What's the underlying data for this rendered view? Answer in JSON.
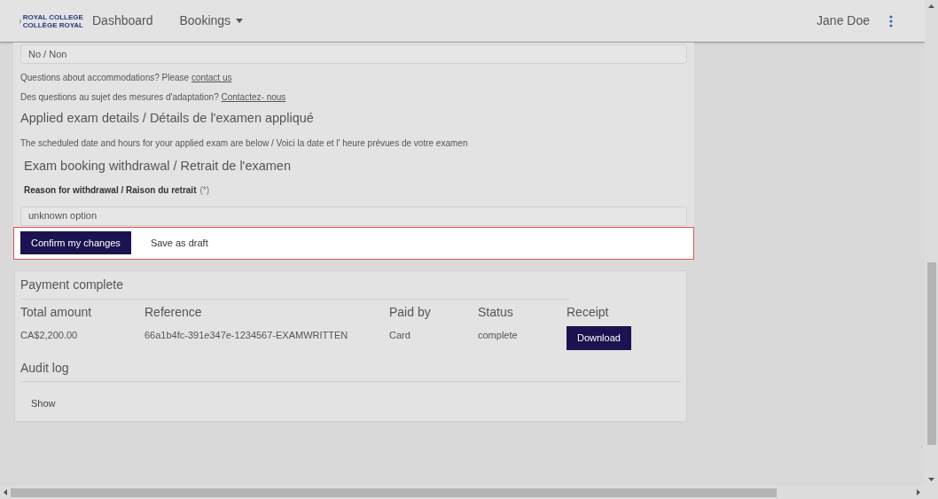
{
  "header": {
    "logo_lines": [
      "ROYAL COLLEGE",
      "COLLÈGE ROYAL"
    ],
    "nav": [
      {
        "label": "Dashboard",
        "has_menu": false
      },
      {
        "label": "Bookings",
        "has_menu": true
      }
    ],
    "user": "Jane Doe"
  },
  "form": {
    "accommodation_value": "No / Non",
    "help_lines": [
      {
        "text": "Questions about accommodations? Please ",
        "link": "contact us"
      },
      {
        "text": "Des questions au sujet des mesures d'adaptation? ",
        "link": "Contactez- nous"
      }
    ],
    "applied_heading": "Applied exam details / Détails de l'examen appliqué",
    "applied_note": "The scheduled date and hours for your applied exam are below / Voici la date et l' heure prévues de votre examen",
    "withdrawal_heading": "Exam booking withdrawal / Retrait de l'examen",
    "reason_label": "Reason for withdrawal / Raison du retrait",
    "reason_required": "(*)",
    "reason_value": "unknown option",
    "actions": [
      {
        "label": "Confirm my changes",
        "kind": "primary"
      },
      {
        "label": "Save as draft",
        "kind": "plain"
      }
    ]
  },
  "payment": {
    "title": "Payment complete",
    "columns": [
      "Total amount",
      "Reference",
      "Paid by",
      "Status",
      "Receipt"
    ],
    "row": {
      "amount": "CA$2,200.00",
      "reference": "66a1b4fc-391e347e-1234567-EXAMWRITTEN",
      "paid_by": "Card",
      "status": "complete",
      "receipt_button": "Download"
    }
  },
  "audit": {
    "title": "Audit log",
    "toggle": "Show"
  }
}
